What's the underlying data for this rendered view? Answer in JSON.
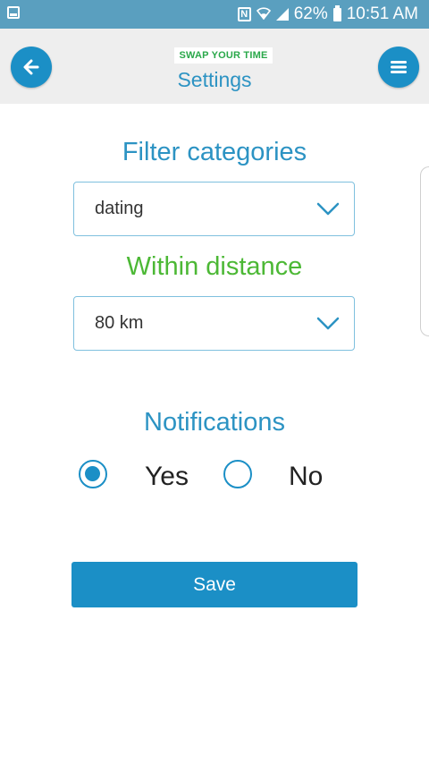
{
  "status_bar": {
    "battery": "62%",
    "time": "10:51 AM",
    "icons": [
      "gallery-notification-icon",
      "nfc-icon",
      "wifi-icon",
      "signal-icon",
      "battery-icon"
    ]
  },
  "header": {
    "brand": "SWAP YOUR TIME",
    "title": "Settings",
    "back_icon": "arrow-left-icon",
    "menu_icon": "hamburger-menu-icon"
  },
  "filter": {
    "title": "Filter categories",
    "selected": "dating"
  },
  "distance": {
    "title": "Within distance",
    "selected": "80 km"
  },
  "notifications": {
    "title": "Notifications",
    "options": [
      {
        "label": "Yes",
        "selected": true
      },
      {
        "label": "No",
        "selected": false
      }
    ]
  },
  "save_label": "Save",
  "colors": {
    "status_bar": "#5a9fbf",
    "primary": "#1b8fc6",
    "title_blue": "#2c93c3",
    "title_green": "#4cb835",
    "brand_green": "#2aa84a",
    "header_bg": "#eeeeee"
  }
}
